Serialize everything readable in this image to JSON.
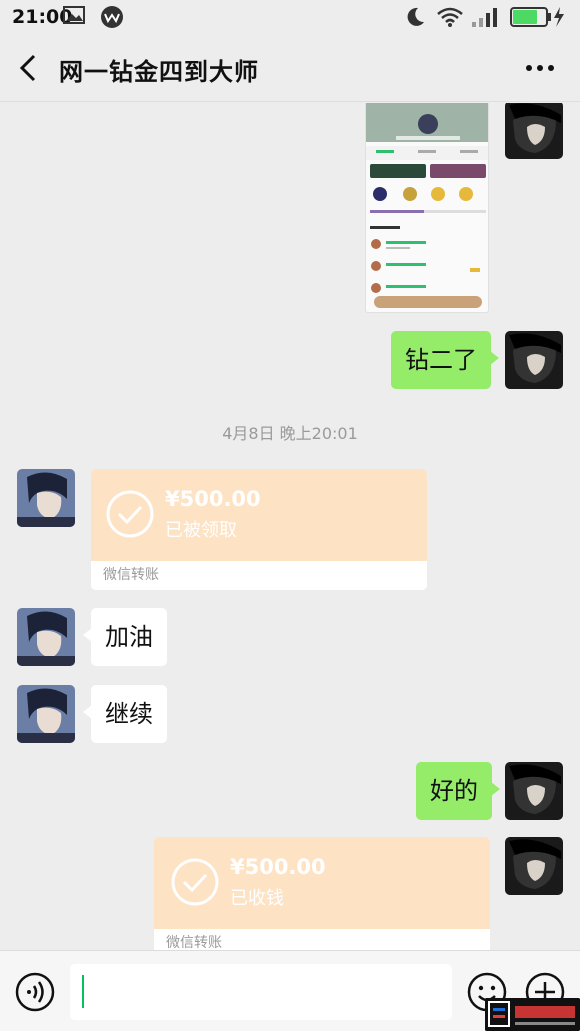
{
  "status_bar": {
    "time": "21:00",
    "icons": [
      "gallery-icon",
      "app-icon",
      "moon-icon",
      "wifi-icon",
      "signal-icon",
      "battery-charging-icon"
    ]
  },
  "header": {
    "title": "网一钻金四到大师",
    "back_icon": "chevron-left-icon",
    "more_icon": "more-dots-icon"
  },
  "messages": {
    "m1": {
      "sender": "me",
      "type": "image",
      "alt": "game profile screenshot"
    },
    "m2": {
      "sender": "me",
      "type": "text",
      "text": "钻二了"
    },
    "timestamp": "4月8日 晚上20:01",
    "m3": {
      "sender": "other",
      "type": "transfer",
      "amount": "¥500.00",
      "status": "已被领取",
      "footer": "微信转账"
    },
    "m4": {
      "sender": "other",
      "type": "text",
      "text": "加油"
    },
    "m5": {
      "sender": "other",
      "type": "text",
      "text": "继续"
    },
    "m6": {
      "sender": "me",
      "type": "text",
      "text": "好的"
    },
    "m7": {
      "sender": "me",
      "type": "transfer",
      "amount": "¥500.00",
      "status": "已收钱",
      "footer": "微信转账"
    }
  },
  "input_bar": {
    "voice_icon": "voice-icon",
    "input_value": "",
    "emoji_icon": "emoji-icon",
    "plus_icon": "plus-icon"
  },
  "colors": {
    "background": "#ededed",
    "my_bubble": "#95ec69",
    "other_bubble": "#ffffff",
    "transfer": "#fde2c4",
    "accent": "#07c160"
  }
}
